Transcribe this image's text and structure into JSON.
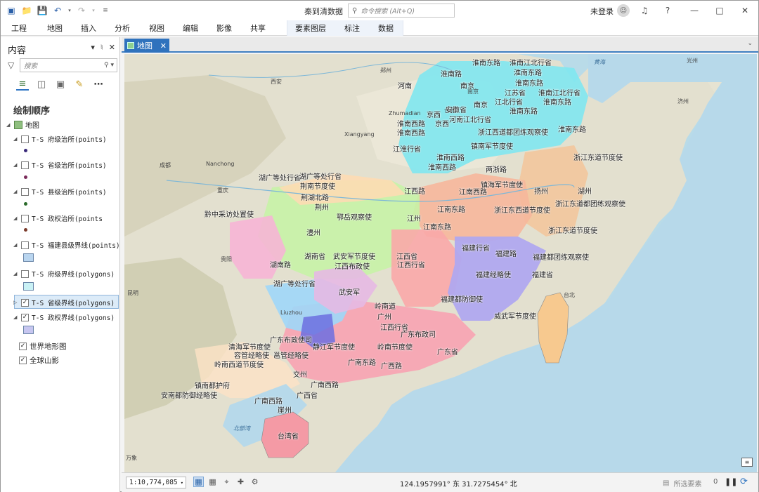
{
  "window": {
    "title": "秦到清数据",
    "command_search_placeholder": "命令搜索 (Alt+Q)",
    "login_label": "未登录",
    "icons": [
      "new-icon",
      "open-icon",
      "save-icon",
      "undo-icon",
      "redo-icon",
      "customize-icon",
      "avatar-icon",
      "bell-icon",
      "help-icon",
      "minimize-icon",
      "maximize-icon",
      "close-icon"
    ]
  },
  "ribbon": {
    "tabs": [
      "工程",
      "地图",
      "插入",
      "分析",
      "视图",
      "编辑",
      "影像",
      "共享"
    ],
    "contextual_tabs": [
      "要素图层",
      "标注",
      "数据"
    ]
  },
  "contents_pane": {
    "title": "内容",
    "search_placeholder": "搜索",
    "heading": "绘制顺序",
    "map_name": "地图",
    "layers": [
      {
        "name": "T-S 府级治所(points)",
        "checked": false,
        "swatch_color": "#3a2a7a"
      },
      {
        "name": "T-S 省级治所(points)",
        "checked": false,
        "swatch_color": "#7a2a5a"
      },
      {
        "name": "T-S 县级治所(points)",
        "checked": false,
        "swatch_color": "#2a6a2a"
      },
      {
        "name": "T-S 政权治所(points",
        "checked": false,
        "swatch_color": "#7a3a2a"
      },
      {
        "name": "T-S 福建县级界线(points)",
        "checked": false,
        "swatch_color": "#b9d5ef"
      },
      {
        "name": "T-S 府级界线(polygons)",
        "checked": false,
        "swatch_color": "#c9f1f5"
      },
      {
        "name": "T-S 省级界线(polygons)",
        "checked": true,
        "swatch_color": ""
      },
      {
        "name": "T-S 政权界线(polygons)",
        "checked": true,
        "swatch_color": "#c7c6f0"
      }
    ],
    "basemaps": [
      {
        "name": "世界地形图",
        "checked": true
      },
      {
        "name": "全球山影",
        "checked": true
      }
    ]
  },
  "map_view": {
    "tab_label": "地图",
    "base_labels": [
      "郑州",
      "西安",
      "Zhumadian",
      "Xiangyang",
      "成都",
      "Nanchong",
      "重庆",
      "贵阳",
      "昆明",
      "Liuzhou",
      "北部湾",
      "台北",
      "济州",
      "黄海",
      "光州",
      "合肥",
      "南京",
      "万象"
    ],
    "region_labels": [
      "淮南东路",
      "淮南江北行省",
      "淮南路",
      "淮南东路",
      "南京",
      "江苏省",
      "淮南东路",
      "淮南江北行省",
      "河南",
      "江北行省",
      "淮南东路",
      "京西",
      "安徽省",
      "南京",
      "淮南东路",
      "淮南西路",
      "京西",
      "河南江北行省",
      "淮南西路",
      "浙江西道都团练观察使",
      "淮南东路",
      "江淮行省",
      "镇南军节度使",
      "浙江东道节度使",
      "淮南西路",
      "淮南西路",
      "两浙路",
      "湖广等处行省",
      "湖广等处行省",
      "荆湖北路",
      "江西路",
      "镇海军节度使",
      "浙江东道都团练观察使",
      "荆南节度使",
      "江南西路",
      "湖州",
      "扬州",
      "荆州",
      "鄂岳观察使",
      "江南东路",
      "浙江东西道节度使",
      "黔中采访处置使",
      "澧州",
      "江州",
      "江南东路",
      "浙江东道节度使",
      "湖南路",
      "武安军节度使",
      "江西行省",
      "福建行省",
      "福建路",
      "福建都团练观察使",
      "湖南省",
      "江西省",
      "福建经略使",
      "江西布政使",
      "福建省",
      "武安军",
      "福建都防御使",
      "威武军节度使",
      "湖广等处行省",
      "岭南道",
      "广州",
      "江西行省",
      "广东布政司",
      "广南东路",
      "静江军节度使",
      "岭南节度使",
      "广东省",
      "广东布政使司",
      "交州",
      "广西路",
      "清海军节度使",
      "邕管经略使",
      "容管经略使",
      "岭南西道节度使",
      "镇南都护府",
      "广南西路",
      "安南都防御经略使",
      "广西省",
      "广南西路",
      "崖州",
      "台湾省"
    ],
    "coordinates_text": "124.1957991° 东  31.7275454° 北"
  },
  "status_bar": {
    "scale": "1:10,774,085",
    "selected_features_label": "所选要素",
    "selected_count": "0"
  }
}
